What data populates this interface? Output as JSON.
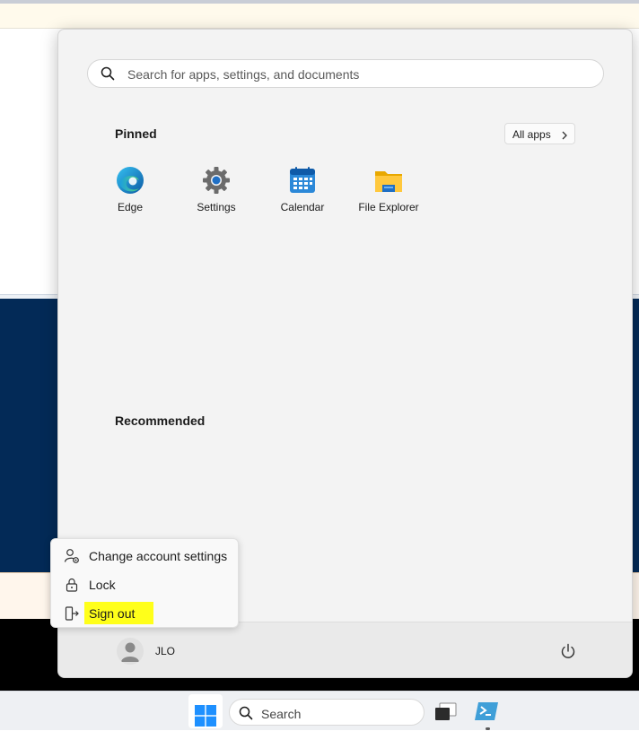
{
  "start_menu": {
    "search": {
      "placeholder": "Search for apps, settings, and documents"
    },
    "pinned_title": "Pinned",
    "all_apps_label": "All apps",
    "pinned_apps": [
      {
        "name": "Edge",
        "icon": "edge-icon"
      },
      {
        "name": "Settings",
        "icon": "settings-gear-icon"
      },
      {
        "name": "Calendar",
        "icon": "calendar-icon"
      },
      {
        "name": "File Explorer",
        "icon": "folder-icon"
      }
    ],
    "recommended_title": "Recommended",
    "user": {
      "name": "JLO"
    }
  },
  "account_menu": {
    "items": [
      {
        "label": "Change account settings",
        "icon": "account-settings-icon"
      },
      {
        "label": "Lock",
        "icon": "lock-icon"
      },
      {
        "label": "Sign out",
        "icon": "sign-out-icon",
        "highlighted": true
      }
    ]
  },
  "taskbar": {
    "search_label": "Search"
  },
  "colors": {
    "accent": "#0067c0",
    "highlight": "#ffff1a",
    "desktop_blue": "#032a57"
  }
}
